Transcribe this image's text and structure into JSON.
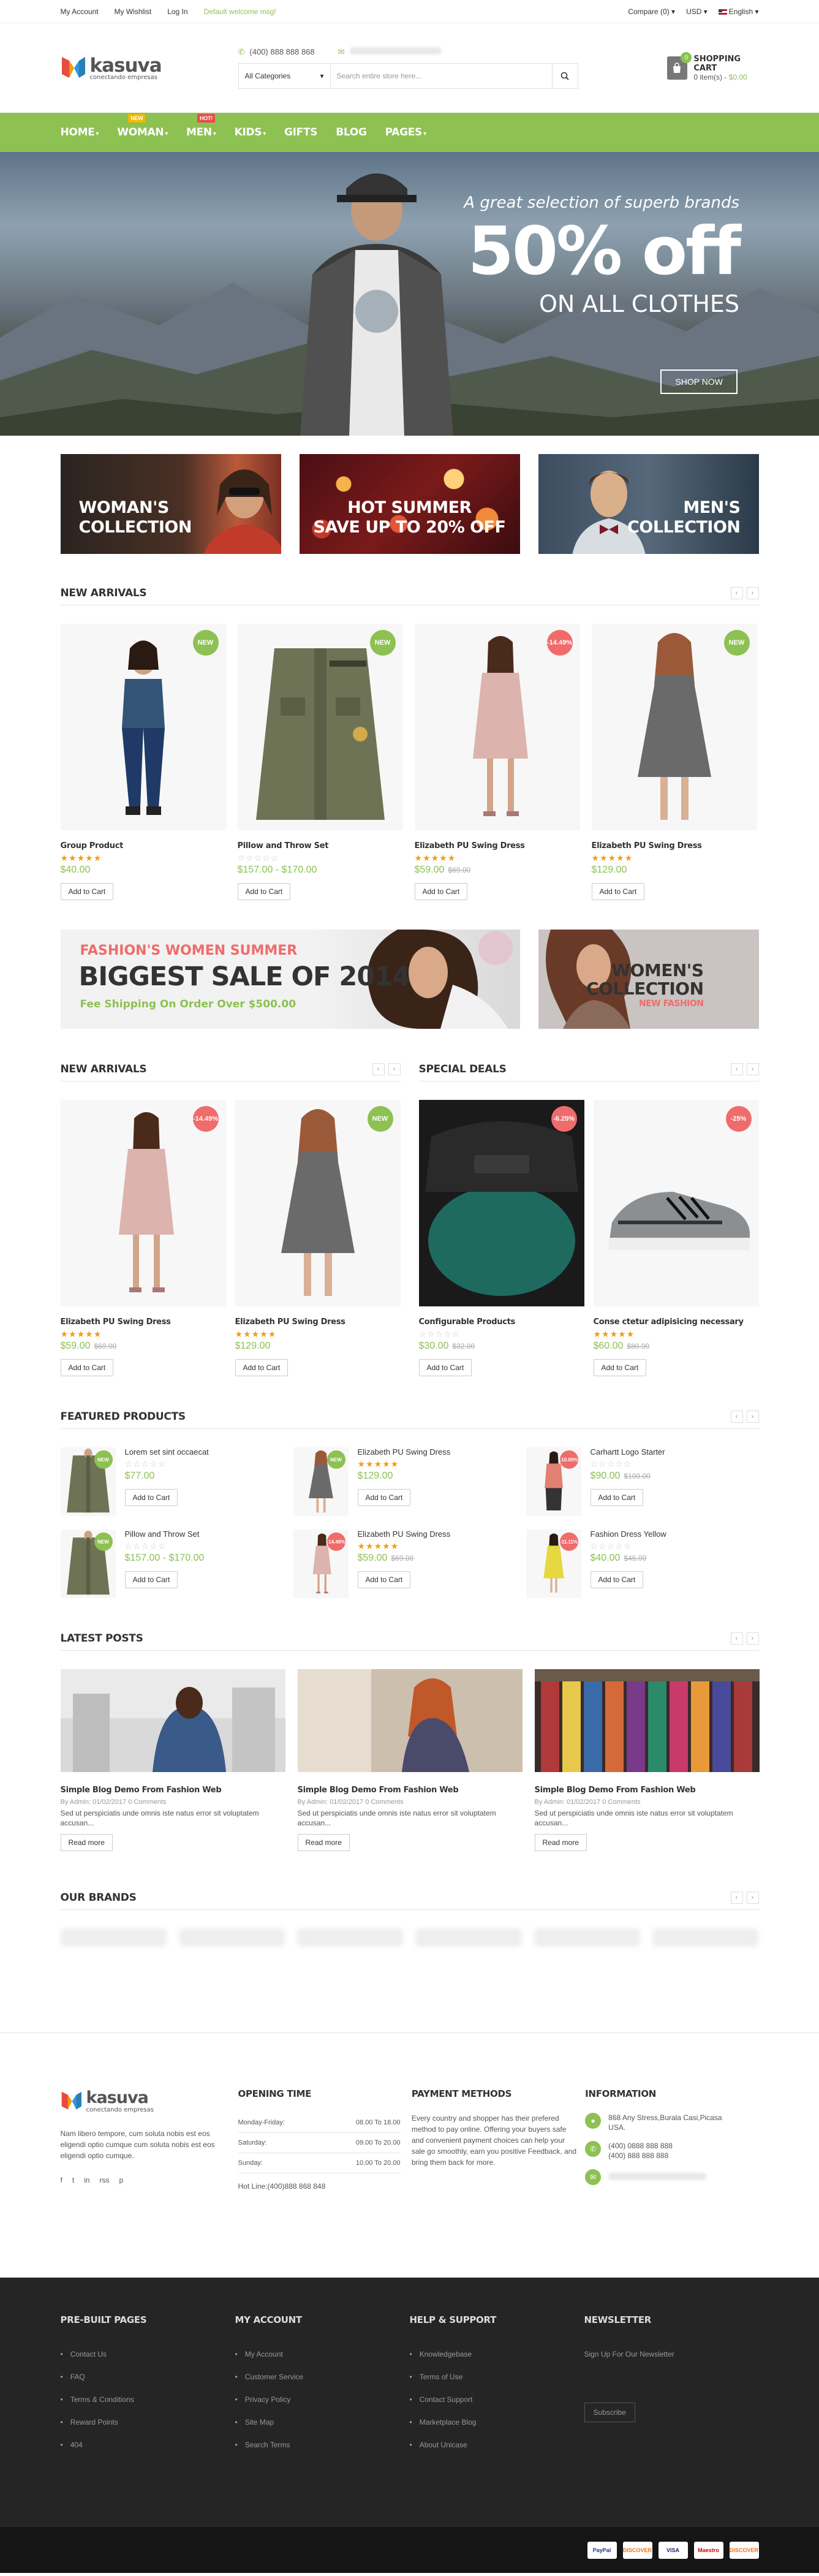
{
  "topbar": {
    "my_account": "My Account",
    "my_wishlist": "My Wishlist",
    "log_in": "Log In",
    "welcome": "Default welcome msg!",
    "compare": "Compare (0) ▾",
    "currency": "USD ▾",
    "language": "English ▾"
  },
  "header": {
    "logo_name": "kasuva",
    "logo_sub": "conectando empresas",
    "phone": "(400) 888 888 868",
    "search_category": "All Categories",
    "search_placeholder": "Search entire store here...",
    "cart_title": "SHOPPING CART",
    "cart_items": "0 item(s) - ",
    "cart_total": "$0.00",
    "cart_count": "0"
  },
  "nav": {
    "items": [
      {
        "label": "HOME",
        "caret": "▾",
        "badge": ""
      },
      {
        "label": "WOMAN",
        "caret": "▾",
        "badge": "NEW"
      },
      {
        "label": "MEN",
        "caret": "▾",
        "badge": "HOT!"
      },
      {
        "label": "KIDS",
        "caret": "▾",
        "badge": ""
      },
      {
        "label": "GIFTS",
        "caret": "",
        "badge": ""
      },
      {
        "label": "BLOG",
        "caret": "",
        "badge": ""
      },
      {
        "label": "PAGES",
        "caret": "▾",
        "badge": ""
      }
    ]
  },
  "hero": {
    "line1": "A great selection of superb brands",
    "line2": "50% off",
    "line3": "ON ALL CLOTHES",
    "button": "SHOP NOW"
  },
  "banners": [
    {
      "line1": "WOMAN'S",
      "line2": "COLLECTION"
    },
    {
      "line1": "HOT SUMMER",
      "line2": "SAVE UP TO 20% OFF"
    },
    {
      "line1": "MEN'S",
      "line2": "COLLECTION"
    }
  ],
  "new_arrivals": {
    "title": "NEW ARRIVALS",
    "products": [
      {
        "name": "Group Product",
        "price": "$40.00",
        "old": "",
        "label": "NEW",
        "stars": "★★★★★",
        "rated": true
      },
      {
        "name": "Pillow and Throw Set",
        "price": "$157.00 - $170.00",
        "old": "",
        "label": "NEW",
        "stars": "☆☆☆☆☆",
        "rated": false
      },
      {
        "name": "Elizabeth PU Swing Dress",
        "price": "$59.00",
        "old": "$69.00",
        "label": "-14.49%",
        "stars": "★★★★★",
        "rated": true
      },
      {
        "name": "Elizabeth PU Swing Dress",
        "price": "$129.00",
        "old": "",
        "label": "NEW",
        "stars": "★★★★★",
        "rated": true
      }
    ]
  },
  "add_to_cart": "Add to Cart",
  "sale_banner": {
    "line1": "FASHION'S WOMEN SUMMER",
    "line2": "BIGGEST SALE OF 2014",
    "line3": "Fee Shipping On Order Over $500.00",
    "side1": "WOMEN'S",
    "side2": "COLLECTION",
    "side3": "NEW FASHION"
  },
  "new_arrivals2": {
    "title": "NEW ARRIVALS",
    "products": [
      {
        "name": "Elizabeth PU Swing Dress",
        "price": "$59.00",
        "old": "$69.00",
        "label": "-14.49%",
        "stars": "★★★★★"
      },
      {
        "name": "Elizabeth PU Swing Dress",
        "price": "$129.00",
        "old": "",
        "label": "NEW",
        "stars": "★★★★★"
      }
    ]
  },
  "special_deals": {
    "title": "SPECIAL DEALS",
    "products": [
      {
        "name": "Configurable Products",
        "price": "$30.00",
        "old": "$32.00",
        "label": "-6.25%",
        "stars": "☆☆☆☆☆"
      },
      {
        "name": "Conse ctetur adipisicing necessary",
        "price": "$60.00",
        "old": "$80.00",
        "label": "-25%",
        "stars": "★★★★★"
      }
    ]
  },
  "featured": {
    "title": "FEATURED PRODUCTS",
    "items": [
      {
        "name": "Lorem set sint occaecat",
        "price": "$77.00",
        "old": "",
        "label": "NEW",
        "stars": "☆☆☆☆☆"
      },
      {
        "name": "Pillow and Throw Set",
        "price": "$157.00 - $170.00",
        "old": "",
        "label": "NEW",
        "stars": "☆☆☆☆☆"
      },
      {
        "name": "Elizabeth PU Swing Dress",
        "price": "$129.00",
        "old": "",
        "label": "NEW",
        "stars": "★★★★★"
      },
      {
        "name": "Elizabeth PU Swing Dress",
        "price": "$59.00",
        "old": "$69.00",
        "label": "-14.49%",
        "stars": "★★★★★"
      },
      {
        "name": "Carhartt Logo Starter",
        "price": "$90.00",
        "old": "$100.00",
        "label": "-10.00%",
        "stars": "☆☆☆☆☆"
      },
      {
        "name": "Fashion Dress Yellow",
        "price": "$40.00",
        "old": "$45.00",
        "label": "-11.11%",
        "stars": "☆☆☆☆☆"
      }
    ]
  },
  "posts": {
    "title": "LATEST POSTS",
    "items": [
      {
        "title": "Simple Blog Demo From Fashion Web",
        "meta": "By Admin: 01/02/2017 0 Comments",
        "excerpt": "Sed ut perspiciatis unde omnis iste natus error sit voluptatem accusan...",
        "more": "Read more"
      },
      {
        "title": "Simple Blog Demo From Fashion Web",
        "meta": "By Admin: 01/02/2017 0 Comments",
        "excerpt": "Sed ut perspiciatis unde omnis iste natus error sit voluptatem accusan...",
        "more": "Read more"
      },
      {
        "title": "Simple Blog Demo From Fashion Web",
        "meta": "By Admin: 01/02/2017 0 Comments",
        "excerpt": "Sed ut perspiciatis unde omnis iste natus error sit voluptatem accusan...",
        "more": "Read more"
      }
    ]
  },
  "brands": {
    "title": "OUR BRANDS"
  },
  "footer": {
    "about": "Nam libero tempore, cum soluta nobis est eos eligendi optio cumque cum soluta nobis est eos eligendi optio cumque.",
    "opening_title": "OPENING TIME",
    "hours": [
      {
        "day": "Monday-Friday:",
        "time": "08.00 To 18.00"
      },
      {
        "day": "Saturday:",
        "time": "09.00 To 20.00"
      },
      {
        "day": "Sunday:",
        "time": "10.00 To 20.00"
      }
    ],
    "hotline": "Hot Line:(400)888 868 848",
    "payment_title": "PAYMENT METHODS",
    "payment_text": "Every country and shopper has their prefered method to pay online. Offering your buyers safe and convenient payment choices can help your sale go smoothly, earn you positive Feedback, and bring them back for more.",
    "info_title": "INFORMATION",
    "address": "868 Any Stress,Burala Casi,Picasa USA.",
    "phone1": "(400) 0888 888 888",
    "phone2": "(400) 888 888 888",
    "social": [
      "f",
      "t",
      "in",
      "rss",
      "p"
    ]
  },
  "footer_bottom": {
    "prebuilt": {
      "title": "PRE-BUILT PAGES",
      "items": [
        "Contact Us",
        "FAQ",
        "Terms & Conditions",
        "Reward Points",
        "404"
      ]
    },
    "account": {
      "title": "MY ACCOUNT",
      "items": [
        "My Account",
        "Customer Service",
        "Privacy Policy",
        "Site Map",
        "Search Terms"
      ]
    },
    "help": {
      "title": "HELP & SUPPORT",
      "items": [
        "Knowledgebase",
        "Terms of Use",
        "Contact Support",
        "Marketplace Blog",
        "About Unicase"
      ]
    },
    "newsletter": {
      "title": "NEWSLETTER",
      "text": "Sign Up For Our Newsletter",
      "button": "Subscribe"
    },
    "payments": [
      "PayPal",
      "DISCOVER",
      "VISA",
      "Maestro",
      "DISCOVER"
    ]
  },
  "colors": {
    "accent": "#8dc152",
    "dark": "#252525",
    "sale": "#f06b6b"
  }
}
